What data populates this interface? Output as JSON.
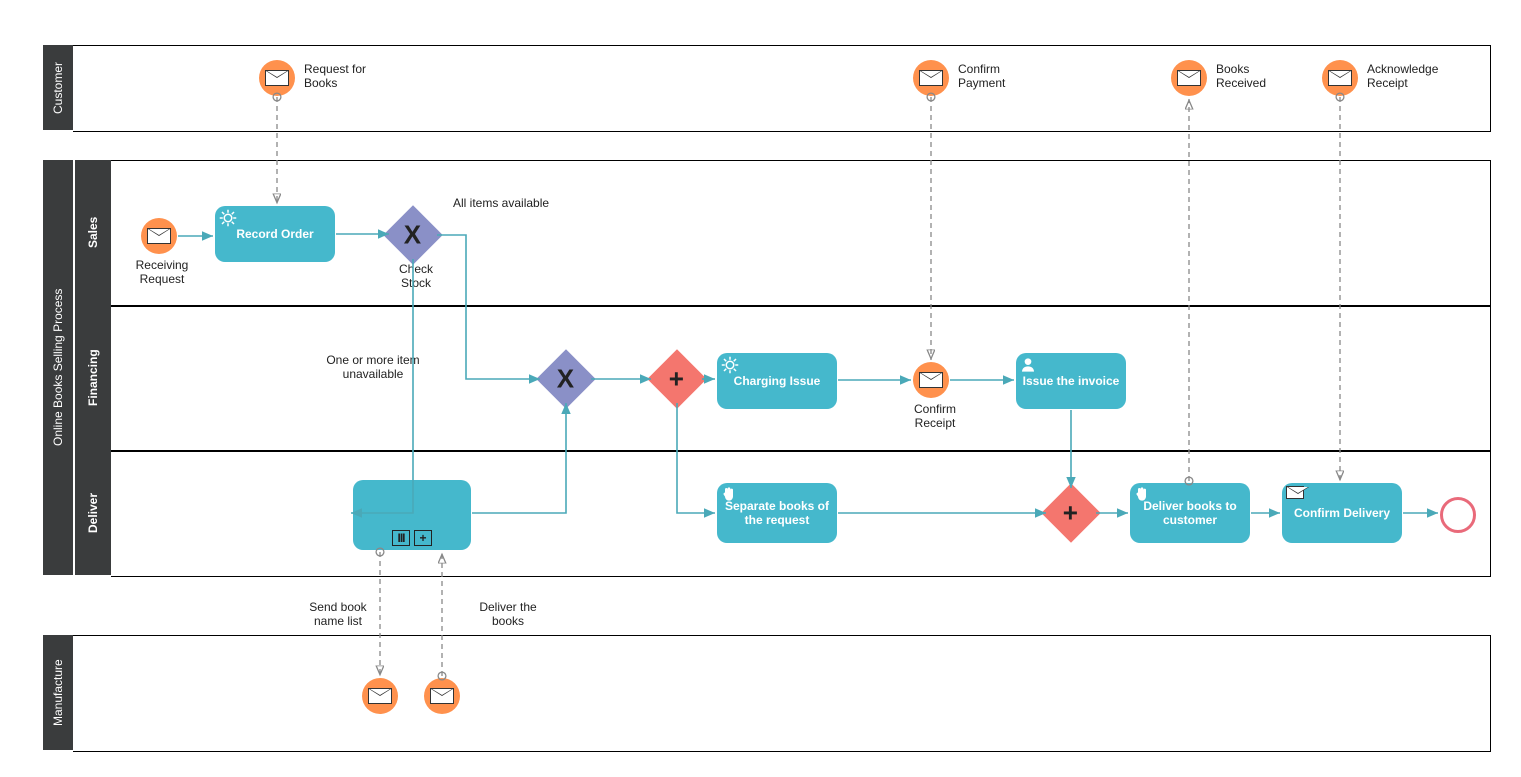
{
  "pools": {
    "customer": "Customer",
    "main": "Online Books Selling Process",
    "manufacture": "Manufacture"
  },
  "lanes": {
    "sales": "Sales",
    "financing": "Financing",
    "deliver": "Deliver"
  },
  "events": {
    "request_for_books": "Request for Books",
    "confirm_payment": "Confirm Payment",
    "books_received": "Books Received",
    "acknowledge_receipt": "Acknowledge Receipt",
    "receiving_request": "Receiving Request",
    "confirm_receipt": "Confirm Receipt",
    "send_book_name_list": "Send book name list",
    "deliver_the_books": "Deliver the books"
  },
  "tasks": {
    "record_order": "Record Order",
    "charging_issue": "Charging Issue",
    "issue_invoice": "Issue the invoice",
    "separate_books": "Separate books of the request",
    "deliver_books": "Deliver books to customer",
    "confirm_delivery": "Confirm Delivery",
    "subprocess": ""
  },
  "gateways": {
    "check_stock": "Check Stock"
  },
  "flows": {
    "all_items": "All items available",
    "unavailable": "One or more item unavailable"
  },
  "colors": {
    "task": "#45b8cc",
    "event": "#ff914d",
    "gateway_x": "#8a90c7",
    "gateway_plus": "#f4766e",
    "lane_header": "#3a3c3d",
    "flow": "#4aa9b8",
    "end_ring": "#e96a7a"
  }
}
